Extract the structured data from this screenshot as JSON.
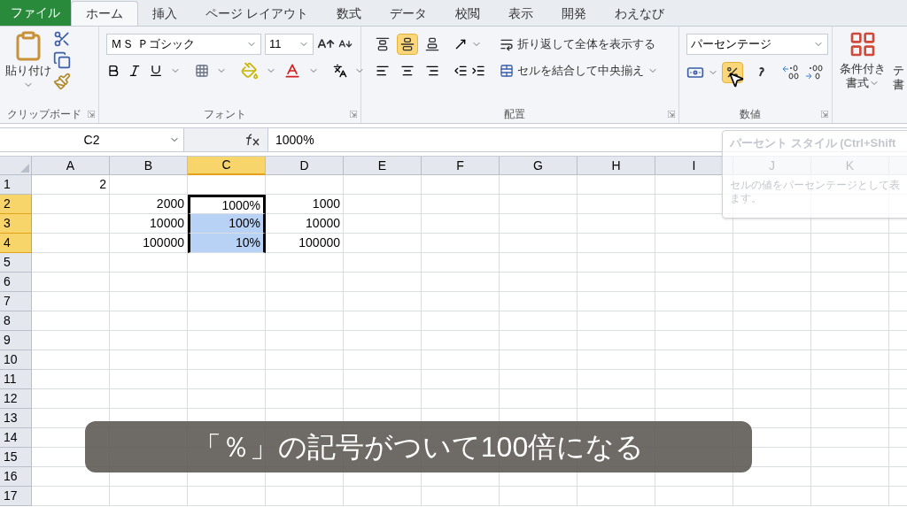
{
  "tabs": [
    {
      "label": "ファイル",
      "kind": "file",
      "selected": false
    },
    {
      "label": "ホーム",
      "kind": "tab",
      "selected": true
    },
    {
      "label": "挿入",
      "kind": "tab",
      "selected": false
    },
    {
      "label": "ページ レイアウト",
      "kind": "tab",
      "selected": false
    },
    {
      "label": "数式",
      "kind": "tab",
      "selected": false
    },
    {
      "label": "データ",
      "kind": "tab",
      "selected": false
    },
    {
      "label": "校閲",
      "kind": "tab",
      "selected": false
    },
    {
      "label": "表示",
      "kind": "tab",
      "selected": false
    },
    {
      "label": "開発",
      "kind": "tab",
      "selected": false
    },
    {
      "label": "わえなび",
      "kind": "tab",
      "selected": false
    }
  ],
  "ribbon": {
    "clipboard": {
      "paste_label": "貼り付け",
      "group_label": "クリップボード"
    },
    "font": {
      "name": "ＭＳ Ｐゴシック",
      "size": "11",
      "group_label": "フォント"
    },
    "alignment": {
      "vertical_buttons": [
        {
          "selected": false
        },
        {
          "selected": true
        },
        {
          "selected": false
        }
      ],
      "wrap_label": "折り返して全体を表示する",
      "merge_label": "セルを結合して中央揃え",
      "group_label": "配置"
    },
    "number": {
      "format": "パーセンテージ",
      "percent_selected": true,
      "group_label": "数値"
    },
    "styles": {
      "conditional_label": "条件付き",
      "conditional_label_2": "書式",
      "cut_label": "テ",
      "cut_label_2": "書"
    }
  },
  "formula_bar": {
    "name_box": "C2",
    "value": "1000%"
  },
  "sheet": {
    "columns": [
      {
        "label": "A",
        "selected": false
      },
      {
        "label": "B",
        "selected": false
      },
      {
        "label": "C",
        "selected": true
      },
      {
        "label": "D",
        "selected": false
      },
      {
        "label": "E",
        "selected": false
      },
      {
        "label": "F",
        "selected": false
      },
      {
        "label": "G",
        "selected": false
      },
      {
        "label": "H",
        "selected": false
      },
      {
        "label": "I",
        "selected": false
      },
      {
        "label": "J",
        "selected": false
      },
      {
        "label": "K",
        "selected": false
      }
    ],
    "rows": [
      {
        "label": "1",
        "selected": false,
        "cells": [
          {
            "value": "2",
            "selected": false,
            "active": false
          }
        ]
      },
      {
        "label": "2",
        "selected": true,
        "cells": [
          null,
          {
            "value": "2000",
            "selected": false,
            "active": false
          },
          {
            "value": "1000%",
            "selected": true,
            "active": true
          },
          {
            "value": "1000",
            "selected": false,
            "active": false
          }
        ]
      },
      {
        "label": "3",
        "selected": true,
        "cells": [
          null,
          {
            "value": "10000",
            "selected": false,
            "active": false
          },
          {
            "value": "100%",
            "selected": true,
            "active": false
          },
          {
            "value": "10000",
            "selected": false,
            "active": false
          }
        ]
      },
      {
        "label": "4",
        "selected": true,
        "cells": [
          null,
          {
            "value": "100000",
            "selected": false,
            "active": false
          },
          {
            "value": "10%",
            "selected": true,
            "active": false
          },
          {
            "value": "100000",
            "selected": false,
            "active": false
          }
        ]
      },
      {
        "label": "5",
        "selected": false,
        "cells": []
      },
      {
        "label": "6",
        "selected": false,
        "cells": []
      },
      {
        "label": "7",
        "selected": false,
        "cells": []
      },
      {
        "label": "8",
        "selected": false,
        "cells": []
      },
      {
        "label": "9",
        "selected": false,
        "cells": []
      },
      {
        "label": "10",
        "selected": false,
        "cells": []
      },
      {
        "label": "11",
        "selected": false,
        "cells": []
      },
      {
        "label": "12",
        "selected": false,
        "cells": []
      },
      {
        "label": "13",
        "selected": false,
        "cells": []
      },
      {
        "label": "14",
        "selected": false,
        "cells": []
      },
      {
        "label": "15",
        "selected": false,
        "cells": []
      },
      {
        "label": "16",
        "selected": false,
        "cells": []
      },
      {
        "label": "17",
        "selected": false,
        "cells": []
      }
    ]
  },
  "tooltip": {
    "title": "パーセント スタイル (Ctrl+Shift",
    "lines": [
      "セルの値をパーセンテージとして表",
      "ます。"
    ]
  },
  "caption": "「％」の記号がついて100倍になる"
}
